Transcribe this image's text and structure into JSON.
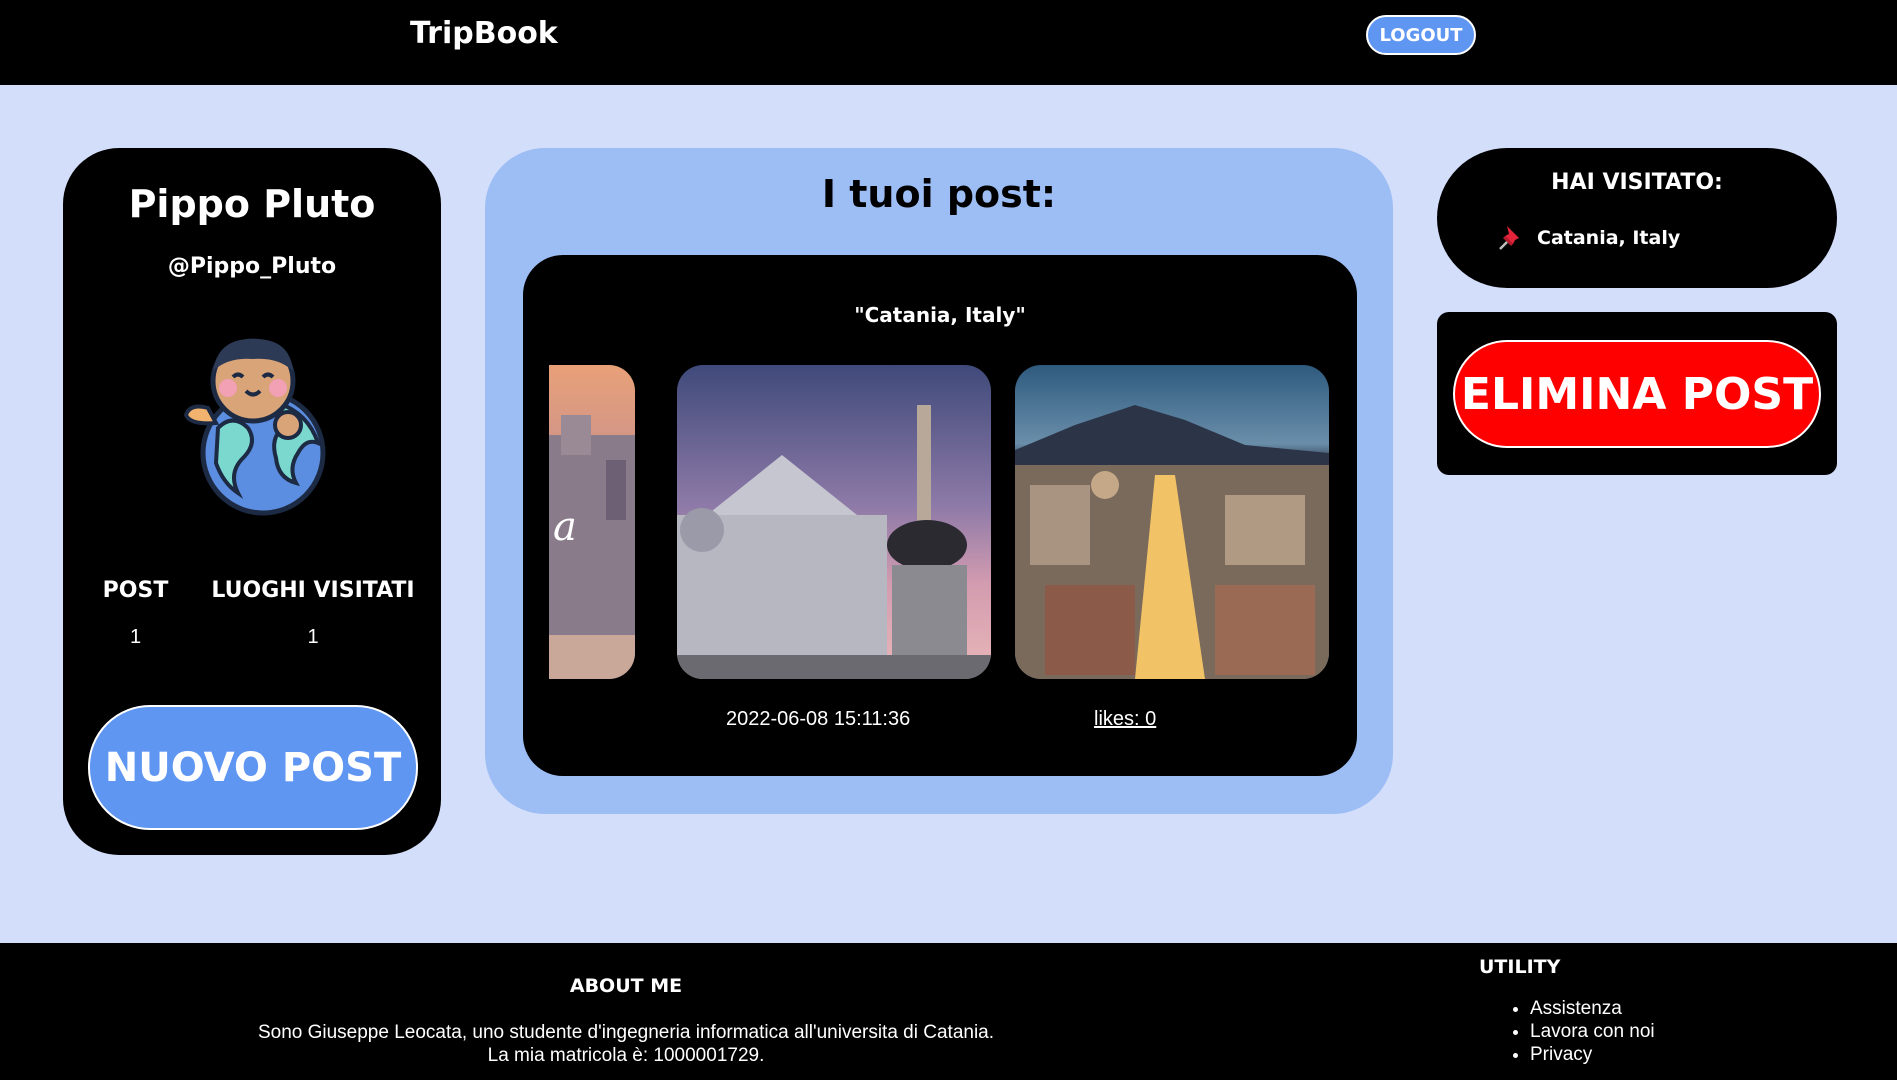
{
  "navbar": {
    "brand": "TripBook",
    "logout_label": "LOGOUT"
  },
  "profile": {
    "name": "Pippo Pluto",
    "handle": "@Pippo_Pluto",
    "stats": [
      {
        "label": "POST",
        "value": "1"
      },
      {
        "label": "LUOGHI VISITATI",
        "value": "1"
      }
    ],
    "new_post_label": "NUOVO POST"
  },
  "posts": {
    "title": "I tuoi post:",
    "post": {
      "location": "\"Catania, Italy\"",
      "date": "2022-06-08 15:11:36",
      "likes": "likes: 0",
      "images": [
        "cathedral-sunset-photo",
        "piazza-duomo-elephant-photo",
        "catania-etna-aerial-photo"
      ]
    }
  },
  "visited": {
    "title": "HAI VISITATO:",
    "items": [
      {
        "icon": "pushpin-icon",
        "label": "Catania, Italy"
      }
    ]
  },
  "delete_label": "ELIMINA POST",
  "footer": {
    "about_title": "ABOUT ME",
    "about_line1": "Sono Giuseppe Leocata, uno studente d'ingegneria informatica all'universita di Catania.",
    "about_line2": "La mia matricola è: 1000001729.",
    "utility_title": "UTILITY",
    "utility_links": [
      "Assistenza",
      "Lavora con noi",
      "Privacy"
    ]
  },
  "colors": {
    "accent": "#5f96f2",
    "danger": "#ff0000",
    "page_bg": "#d2defa",
    "panel_bg": "#9dbdf5"
  }
}
